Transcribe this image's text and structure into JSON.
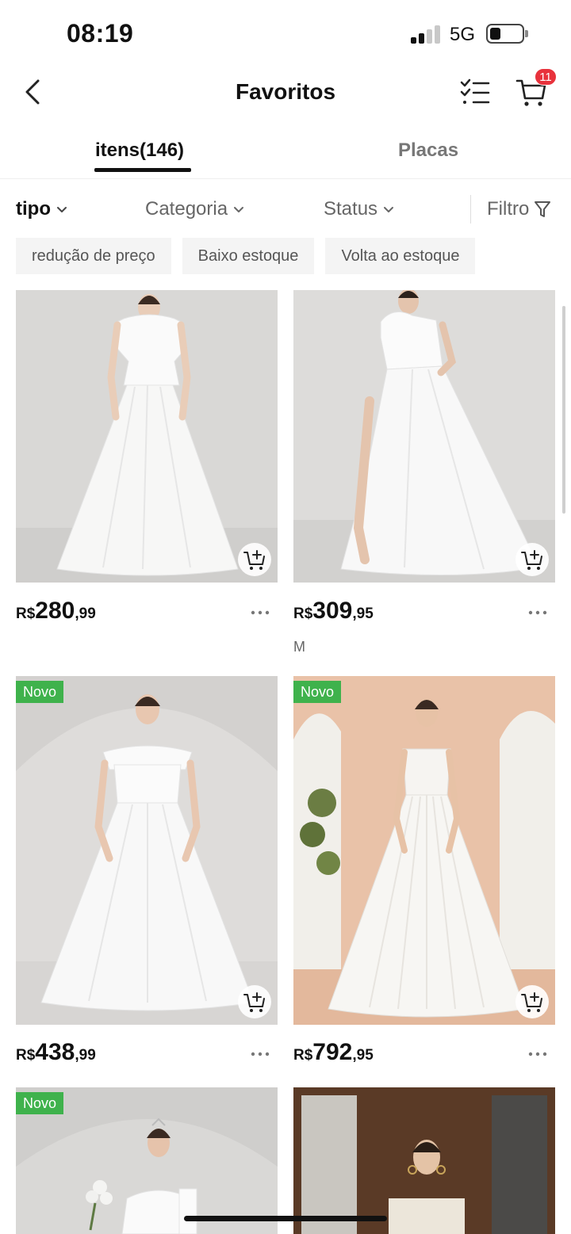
{
  "status_bar": {
    "time": "08:19",
    "network": "5G"
  },
  "header": {
    "title": "Favoritos",
    "cart_count": "11"
  },
  "tabs": [
    {
      "label": "itens(146)",
      "active": true
    },
    {
      "label": "Placas",
      "active": false
    }
  ],
  "filters": [
    {
      "label": "tipo"
    },
    {
      "label": "Categoria"
    },
    {
      "label": "Status"
    },
    {
      "label": "Filtro"
    }
  ],
  "chips": [
    {
      "label": "redução de preço"
    },
    {
      "label": "Baixo estoque"
    },
    {
      "label": "Volta ao estoque"
    }
  ],
  "products": [
    {
      "currency": "R$",
      "price_int": "280",
      "price_dec": ",99",
      "attribute": "",
      "new_badge": ""
    },
    {
      "currency": "R$",
      "price_int": "309",
      "price_dec": ",95",
      "attribute": "M",
      "new_badge": ""
    },
    {
      "currency": "R$",
      "price_int": "438",
      "price_dec": ",99",
      "attribute": "",
      "new_badge": "Novo"
    },
    {
      "currency": "R$",
      "price_int": "792",
      "price_dec": ",95",
      "attribute": "",
      "new_badge": "Novo"
    },
    {
      "currency": "",
      "price_int": "",
      "price_dec": "",
      "attribute": "",
      "new_badge": "Novo"
    },
    {
      "currency": "",
      "price_int": "",
      "price_dec": "",
      "attribute": "",
      "new_badge": ""
    }
  ],
  "icons": {
    "back": "chevron-left-icon",
    "checklist": "checklist-icon",
    "cart": "cart-icon",
    "filter": "funnel-icon",
    "add_to_cart": "cart-plus-icon",
    "more": "more-dots-icon"
  },
  "colors": {
    "badge_new": "#3fb24c",
    "cart_badge": "#e8323c",
    "chip_bg": "#f4f4f4"
  }
}
